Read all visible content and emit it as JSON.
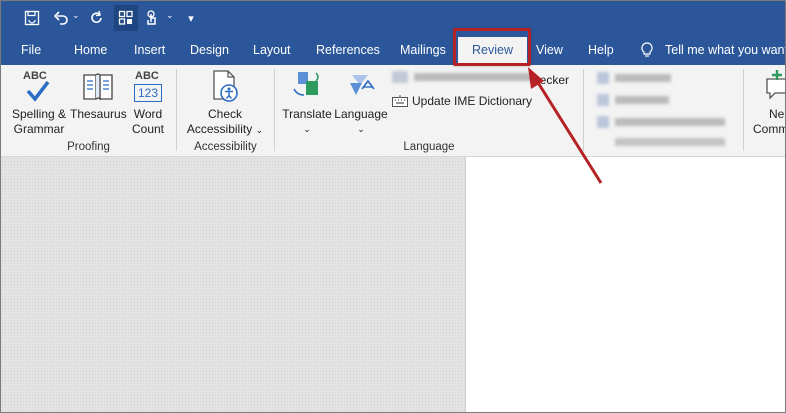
{
  "quick_access": {
    "icons": [
      "save-icon",
      "undo-icon",
      "redo-icon",
      "touch-mode-icon",
      "touch-icon",
      "customize-icon"
    ]
  },
  "tabs": [
    {
      "label": "File",
      "selected": false
    },
    {
      "label": "Home",
      "selected": false
    },
    {
      "label": "Insert",
      "selected": false
    },
    {
      "label": "Design",
      "selected": false
    },
    {
      "label": "Layout",
      "selected": false
    },
    {
      "label": "References",
      "selected": false
    },
    {
      "label": "Mailings",
      "selected": false
    },
    {
      "label": "Review",
      "selected": true
    },
    {
      "label": "View",
      "selected": false
    },
    {
      "label": "Help",
      "selected": false
    }
  ],
  "tell_me": "Tell me what you want",
  "ribbon": {
    "proofing": {
      "spelling_line1": "Spelling &",
      "spelling_line2": "Grammar",
      "thesaurus": "Thesaurus",
      "wordcount_line1": "Word",
      "wordcount_line2": "Count",
      "abc": "ABC",
      "num": "123",
      "label": "Proofing"
    },
    "accessibility": {
      "check_line1": "Check",
      "check_line2": "Accessibility",
      "label": "Accessibility"
    },
    "language": {
      "translate": "Translate",
      "language": "Language",
      "checker_partial": "hecker",
      "update_ime": "Update IME Dictionary",
      "label": "Language"
    },
    "comments": {
      "new_partial": "Ne",
      "comment_partial": "Comm"
    }
  },
  "colors": {
    "titlebar": "#2b579a",
    "ribbon": "#f3f3f3",
    "annotation": "#b52226"
  }
}
